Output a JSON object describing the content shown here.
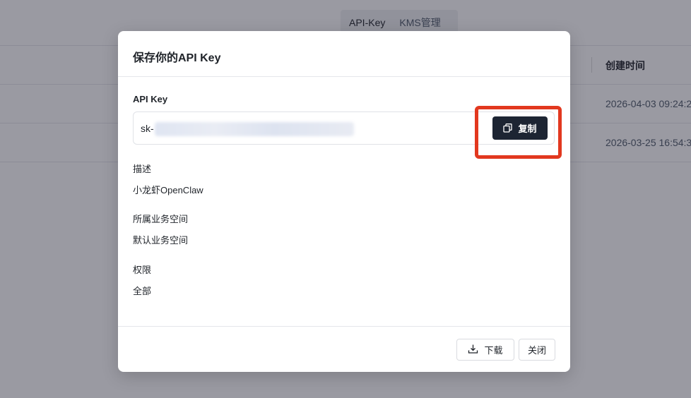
{
  "background": {
    "tabs": [
      "API-Key",
      "KMS管理"
    ],
    "column_header": "创建时间",
    "rows": [
      {
        "created_at": "2026-04-03 09:24:2"
      },
      {
        "created_at": "2026-03-25 16:54:3"
      }
    ]
  },
  "modal": {
    "title": "保存你的API Key",
    "api_key_label": "API Key",
    "api_key_prefix": "sk-",
    "copy_label": "复制",
    "description_label": "描述",
    "description_value": "小龙虾OpenClaw",
    "workspace_label": "所属业务空间",
    "workspace_value": "默认业务空间",
    "permission_label": "权限",
    "permission_value": "全部",
    "download_label": "下载",
    "close_label": "关闭"
  },
  "colors": {
    "overlay": "#1e2030",
    "copy_button": "#1d2533",
    "highlight": "#e2381f"
  },
  "icons": {
    "copy": "copy-icon",
    "download": "download-icon"
  }
}
